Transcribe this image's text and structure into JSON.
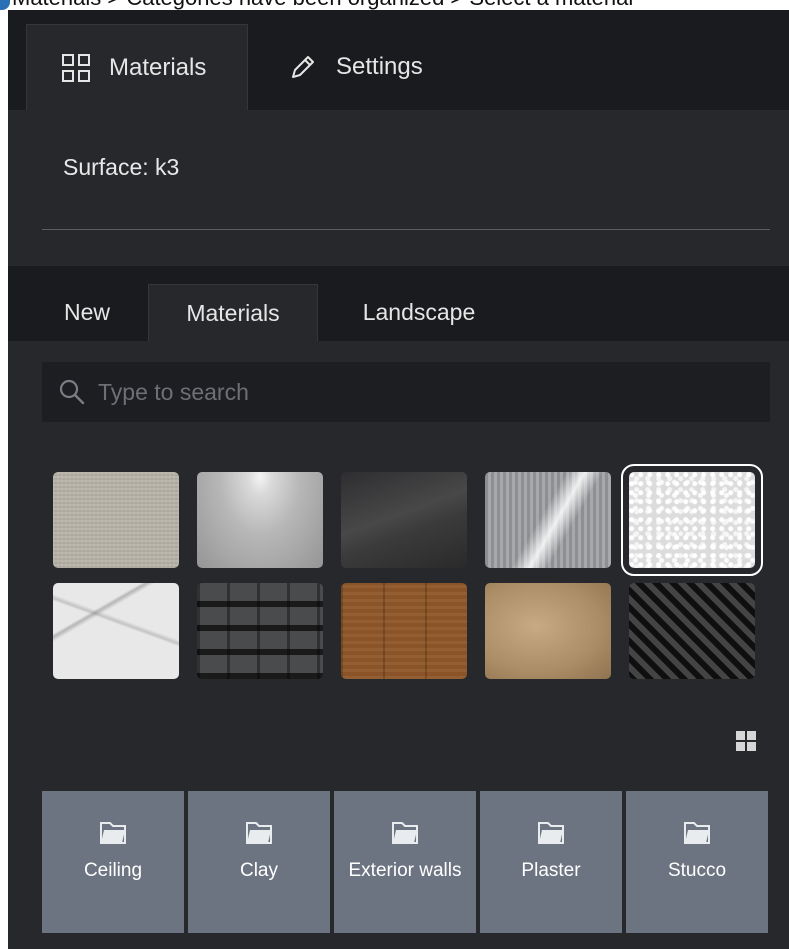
{
  "top_strip_text": "Materials > Categories have been organized > Select a material",
  "main_tabs": [
    {
      "label": "Materials",
      "icon": "grid-icon",
      "active": true
    },
    {
      "label": "Settings",
      "icon": "pencil-icon",
      "active": false
    }
  ],
  "surface": {
    "label": "Surface: k3"
  },
  "sub_tabs": [
    {
      "label": "New",
      "active": false
    },
    {
      "label": "Materials",
      "active": true
    },
    {
      "label": "Landscape",
      "active": false
    }
  ],
  "search": {
    "placeholder": "Type to search",
    "value": ""
  },
  "swatches": [
    {
      "name": "linen",
      "selected": false
    },
    {
      "name": "matte-grey",
      "selected": false
    },
    {
      "name": "dark-gloss",
      "selected": false
    },
    {
      "name": "brushed-metal",
      "selected": false
    },
    {
      "name": "white-stucco",
      "selected": true
    },
    {
      "name": "marble",
      "selected": false
    },
    {
      "name": "roof-tiles",
      "selected": false
    },
    {
      "name": "wood",
      "selected": false
    },
    {
      "name": "tan-stone",
      "selected": false
    },
    {
      "name": "dark-pattern",
      "selected": false
    }
  ],
  "categories": [
    {
      "label": "Ceiling"
    },
    {
      "label": "Clay"
    },
    {
      "label": "Exterior walls"
    },
    {
      "label": "Plaster"
    },
    {
      "label": "Stucco"
    }
  ],
  "colors": {
    "panel_bg": "#26282c",
    "tabbar_bg": "#1a1b1e",
    "category_bg": "#6b7480",
    "text": "#e6e6e6"
  }
}
